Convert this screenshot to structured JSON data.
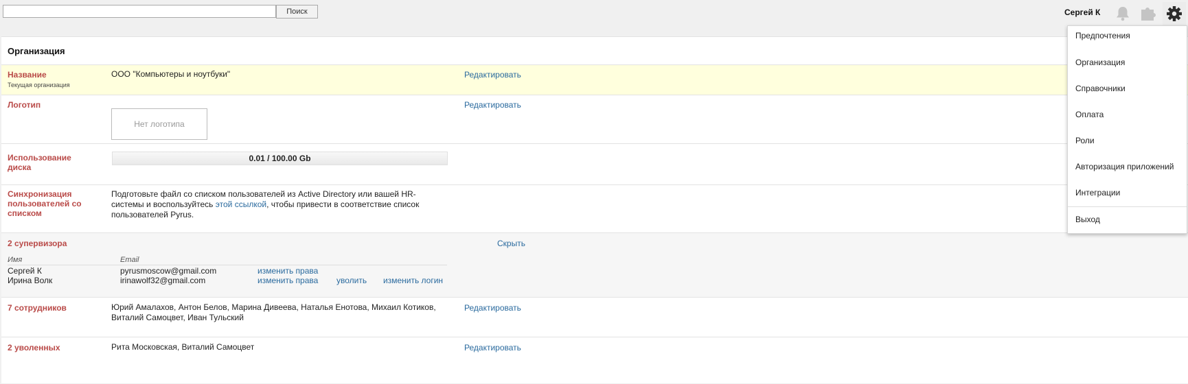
{
  "search": {
    "placeholder": "",
    "value": "",
    "button_label": "Поиск"
  },
  "user": {
    "name": "Сергей К"
  },
  "icons": {
    "bell": "bell-icon",
    "puzzle": "puzzle-icon",
    "gear": "gear-icon"
  },
  "page": {
    "title": "Организация"
  },
  "org": {
    "name_label": "Название",
    "name_sub": "Текущая организация",
    "name_value": "ООО \"Компьютеры и ноутбуки\"",
    "edit_label": "Редактировать",
    "logo_label": "Логотип",
    "logo_placeholder": "Нет логотипа",
    "disk_label": "Использование диска",
    "disk_usage_text": "0.01 / 100.00 Gb",
    "disk_usage_fraction": 0.0001,
    "sync_label": "Синхронизация пользователей со списком",
    "sync_text_1": "Подготовьте файл со списком пользователей из Active Directory или вашей HR-системы и воспользуйтесь",
    "sync_link": "этой ссылкой",
    "sync_text_2": ", чтобы привести в соответствие список пользователей Pyrus."
  },
  "supervisors": {
    "label": "2 супервизора",
    "hide_label": "Скрыть",
    "col_name": "Имя",
    "col_email": "Email",
    "rows": [
      {
        "name": "Сергей К",
        "email": "pyrusmoscow@gmail.com",
        "rights": "изменить права"
      },
      {
        "name": "Ирина Волк",
        "email": "irinawolf32@gmail.com",
        "rights": "изменить права",
        "remove": "уволить",
        "login": "изменить логин"
      }
    ]
  },
  "employees": {
    "label": "7 сотрудников",
    "value": "Юрий Амалахов, Антон Белов, Марина Дивеева, Наталья Енотова, Михаил Котиков, Виталий Самоцвет, Иван Тульский",
    "edit_label": "Редактировать"
  },
  "fired": {
    "label": "2 уволенных",
    "value": "Рита Московская, Виталий Самоцвет",
    "edit_label": "Редактировать"
  },
  "menu": {
    "items": [
      "Предпочтения",
      "Организация",
      "Справочники",
      "Оплата",
      "Роли",
      "Авторизация приложений",
      "Интеграции"
    ],
    "logout": "Выход"
  }
}
